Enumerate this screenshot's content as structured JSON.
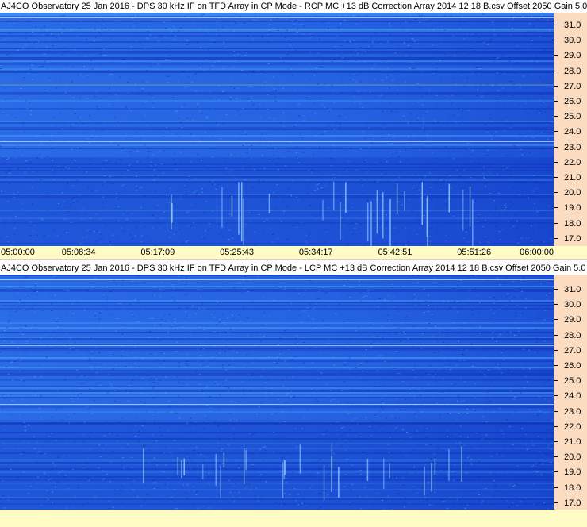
{
  "rcp_panel": {
    "title": "AJ4CO Observatory 25 Jan 2016 - DPS 30 kHz IF on TFD Array in CP Mode - RCP  MC +13 dB  Correction Array 2014 12 18 B.csv  Offset 2050  Gain 5.0",
    "freq_ticks": [
      "31.0",
      "30.0",
      "29.0",
      "28.0",
      "27.0",
      "26.0",
      "25.0",
      "24.0",
      "23.0",
      "22.0",
      "21.0",
      "20.0",
      "19.0",
      "18.0",
      "17.0"
    ],
    "time_ticks": [
      "05:00:00",
      "05:08:34",
      "05:17:09",
      "05:25:43",
      "05:34:17",
      "05:42:51",
      "05:51:26",
      "06:00:00"
    ]
  },
  "lcp_panel": {
    "title": "AJ4CO Observatory 25 Jan 2016 - DPS 30 kHz IF on TFD Array in CP Mode - LCP  MC +13 dB  Correction Array 2014 12 18 B.csv  Offset 2050  Gain 5.0",
    "freq_ticks": [
      "31.0",
      "30.0",
      "29.0",
      "28.0",
      "27.0",
      "26.0",
      "25.0",
      "24.0",
      "23.0",
      "22.0",
      "21.0",
      "20.0",
      "19.0",
      "18.0",
      "17.0"
    ]
  },
  "colors": {
    "spectrogram_base": "#1f55d8",
    "spectrogram_bright": "#3a8cf0",
    "spectrogram_dark": "#0f3ac0",
    "freq_axis_bg": "#fbdcc0",
    "time_axis_bg": "#fefbc4"
  }
}
